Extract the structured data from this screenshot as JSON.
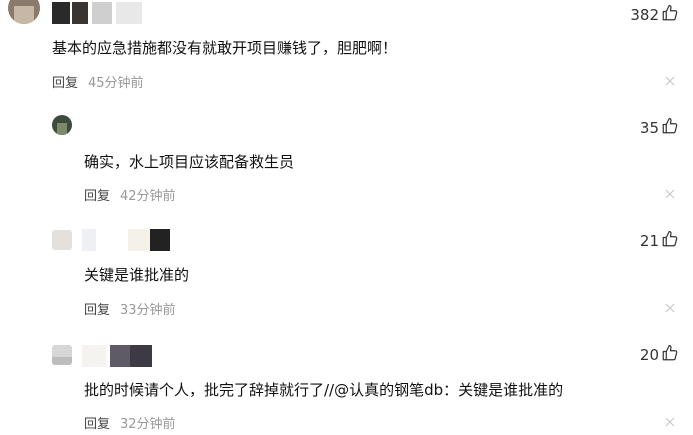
{
  "comments": [
    {
      "username": "",
      "text": "基本的应急措施都没有就敢开项目赚钱了，胆肥啊！",
      "likes": "382",
      "reply_label": "回复",
      "time": "45分钟前"
    },
    {
      "username": "",
      "text": "确实，水上项目应该配备救生员",
      "likes": "35",
      "reply_label": "回复",
      "time": "42分钟前"
    },
    {
      "username": "",
      "text": "关键是谁批准的",
      "likes": "21",
      "reply_label": "回复",
      "time": "33分钟前"
    },
    {
      "username": "",
      "text": "批的时候请个人，批完了辞掉就行了//@认真的钢笔db：关键是谁批准的",
      "likes": "20",
      "reply_label": "回复",
      "time": "32分钟前"
    }
  ],
  "icons": {
    "like": "thumbs-up-icon",
    "close": "close-icon"
  },
  "colors": {
    "text": "#111111",
    "meta": "#999999",
    "reply": "#444444"
  }
}
